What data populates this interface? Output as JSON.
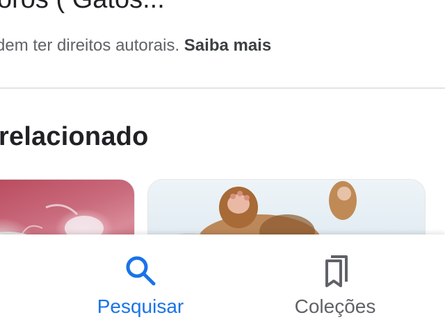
{
  "header": {
    "title": "oros ( Gatos..."
  },
  "copyright_notice": {
    "text": "dem ter direitos autorais.",
    "link_label": "Saiba mais"
  },
  "related": {
    "section_title": "relacionado"
  },
  "bottom_nav": {
    "items": [
      {
        "label": "Pesquisar",
        "icon": "search-icon",
        "active": true,
        "color": "#1a73e8"
      },
      {
        "label": "Coleções",
        "icon": "bookmarks-icon",
        "active": false,
        "color": "#5f6368"
      }
    ]
  }
}
